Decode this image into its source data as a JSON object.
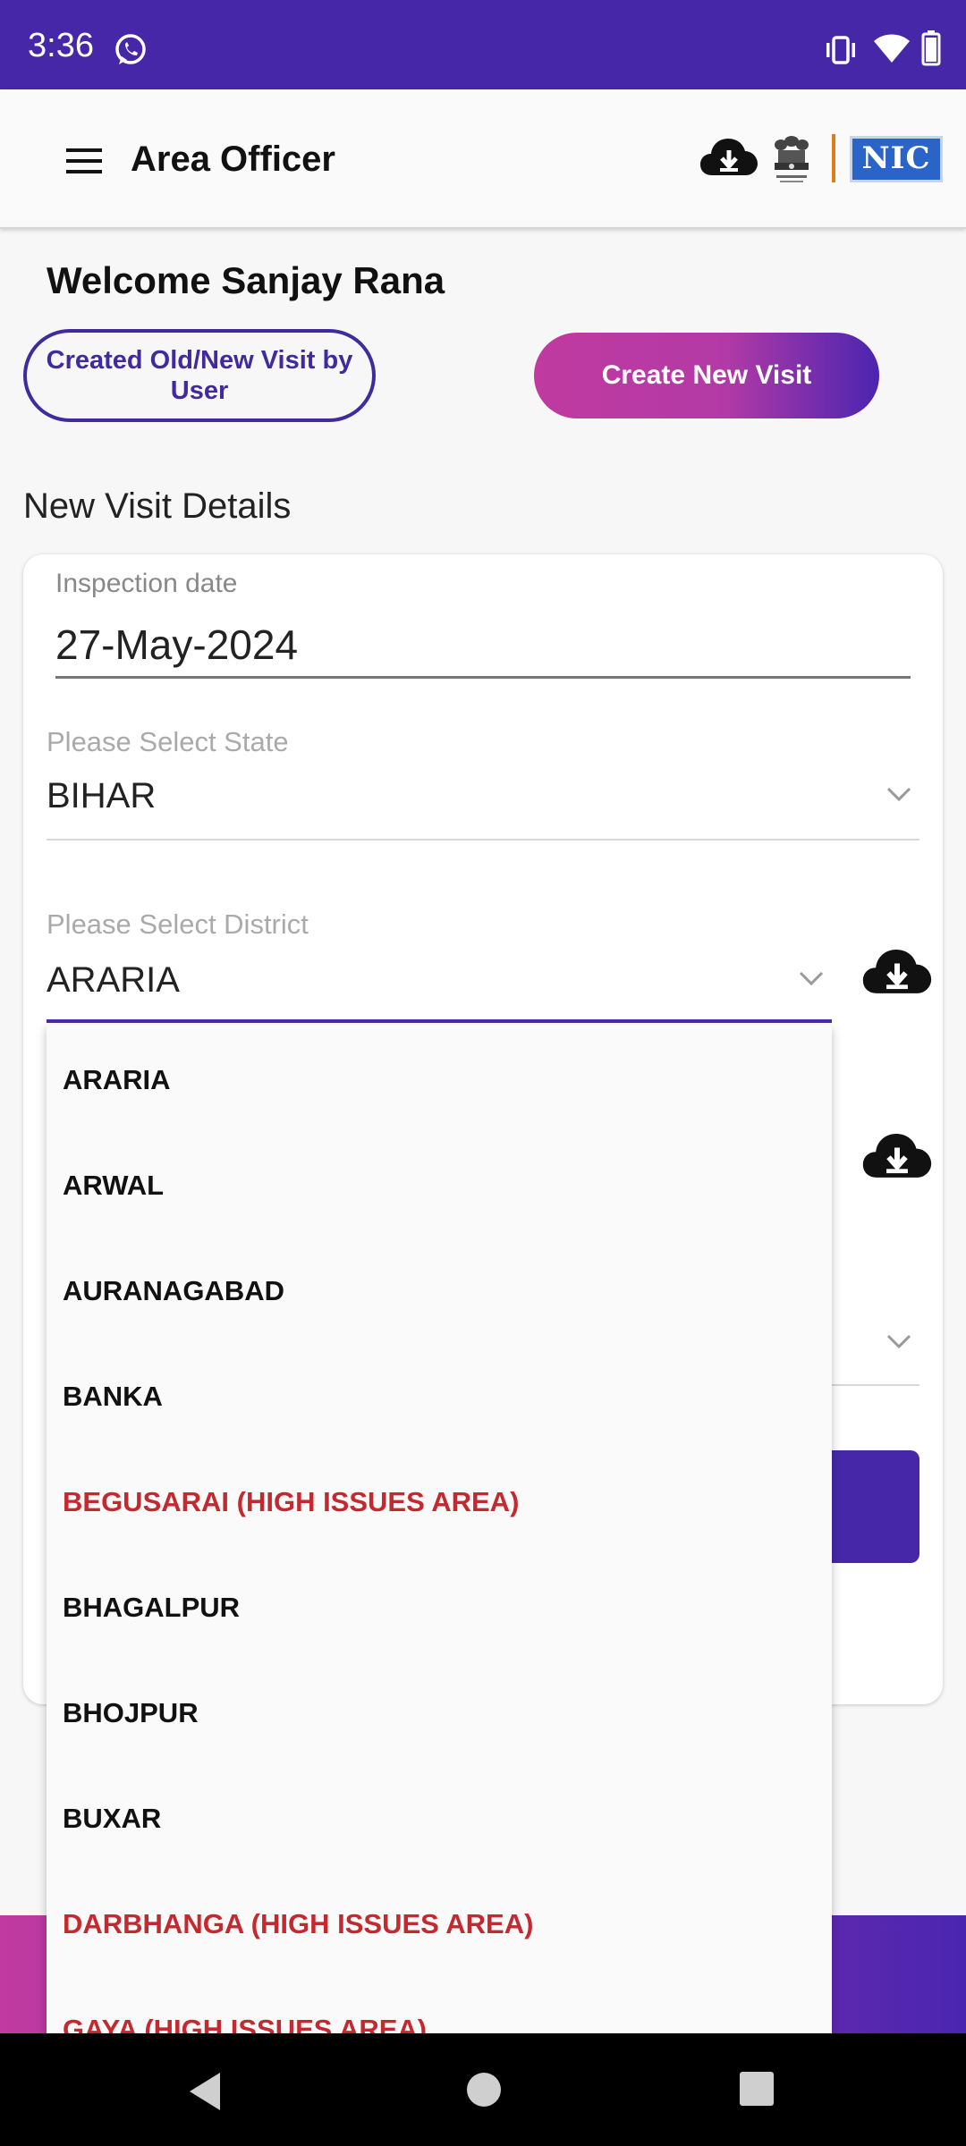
{
  "status_bar": {
    "time": "3:36",
    "icons": [
      "whatsapp-icon",
      "vibrate-icon",
      "wifi-icon",
      "battery-icon"
    ]
  },
  "app_bar": {
    "title": "Area Officer",
    "icons": [
      "menu-icon",
      "cloud-download-icon",
      "emblem-icon"
    ],
    "logo_text": "NIC"
  },
  "welcome": {
    "text": "Welcome Sanjay Rana",
    "created_visit_button": "Created Old/New Visit by User",
    "create_new_button": "Create New Visit"
  },
  "form": {
    "section_title": "New Visit Details",
    "inspection": {
      "label": "Inspection date",
      "value": "27-May-2024"
    },
    "state": {
      "label": "Please Select State",
      "value": "BIHAR"
    },
    "district": {
      "label": "Please Select District",
      "value": "ARARIA"
    }
  },
  "district_dropdown": {
    "items": [
      {
        "label": "ARARIA",
        "high_issue": false
      },
      {
        "label": "ARWAL",
        "high_issue": false
      },
      {
        "label": "AURANAGABAD",
        "high_issue": false
      },
      {
        "label": "BANKA",
        "high_issue": false
      },
      {
        "label": "BEGUSARAI (HIGH ISSUES AREA)",
        "high_issue": true
      },
      {
        "label": "BHAGALPUR",
        "high_issue": false
      },
      {
        "label": "BHOJPUR",
        "high_issue": false
      },
      {
        "label": "BUXAR",
        "high_issue": false
      },
      {
        "label": "DARBHANGA (HIGH ISSUES AREA)",
        "high_issue": true
      },
      {
        "label": "GAYA (HIGH ISSUES AREA)",
        "high_issue": true
      }
    ]
  },
  "colors": {
    "primary": "#4527a8",
    "accent_pink": "#c03aa0",
    "high_issue_text": "#c4292f"
  }
}
